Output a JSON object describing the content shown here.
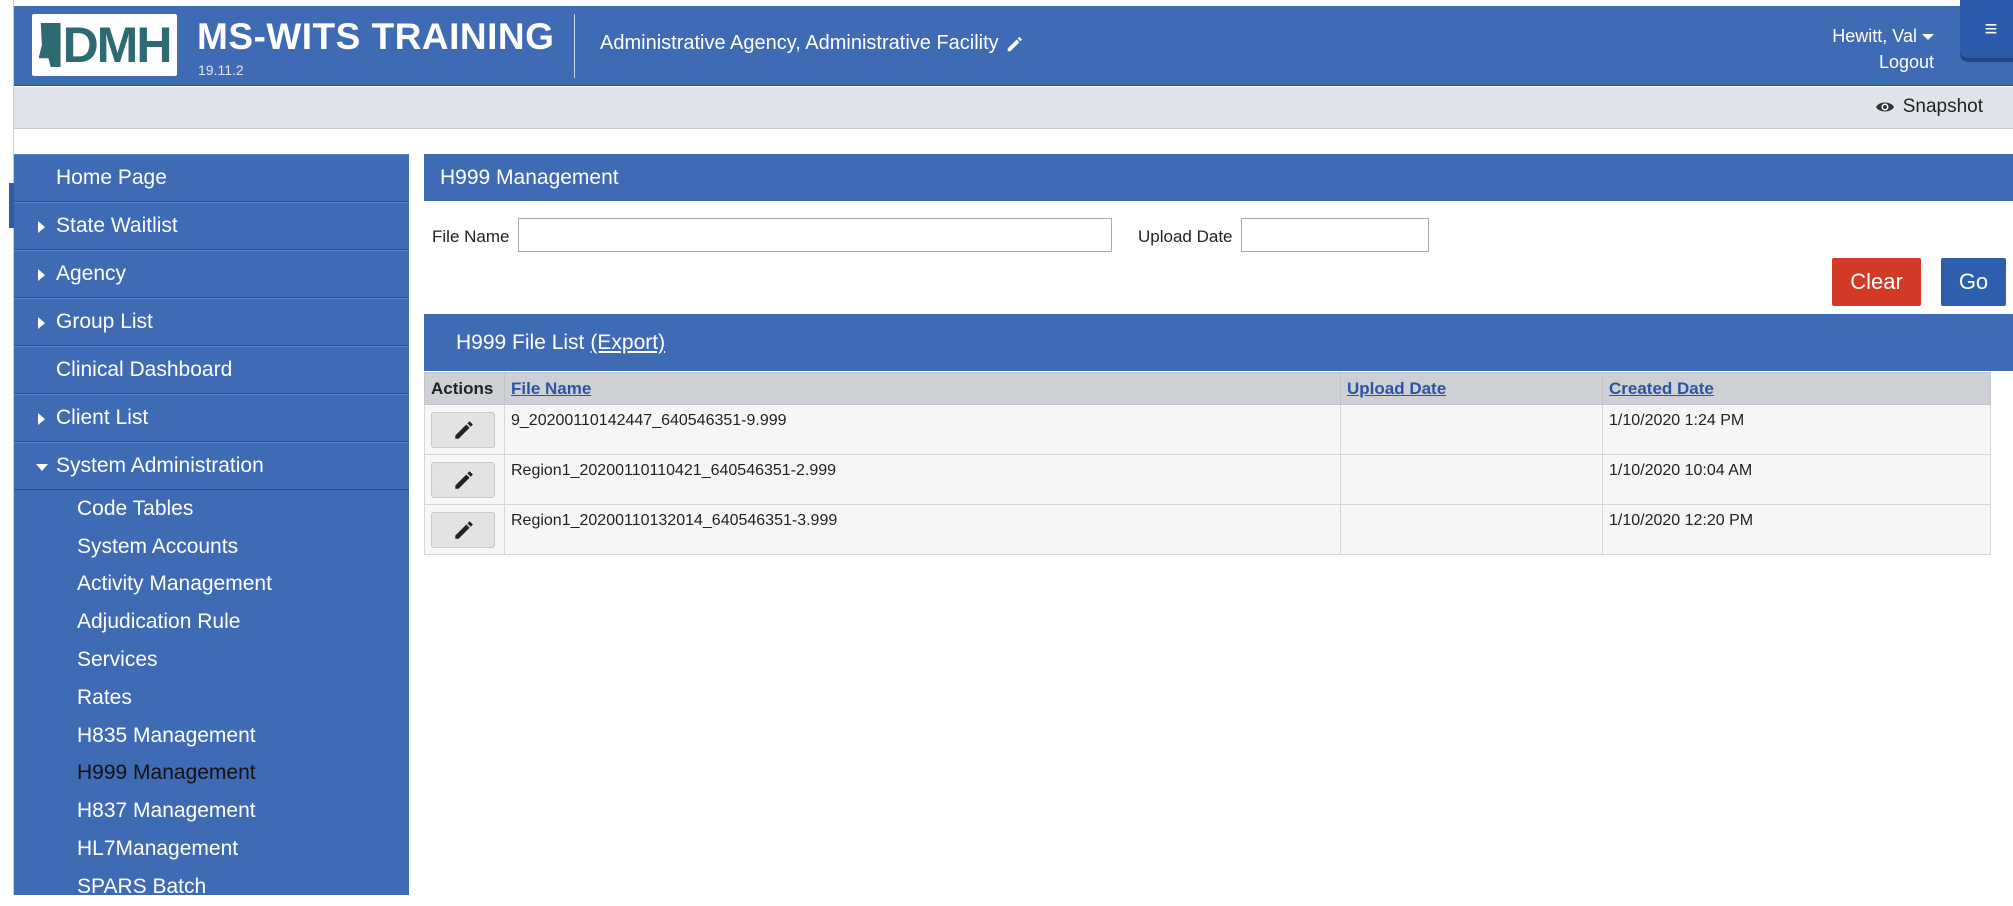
{
  "header": {
    "logo_text": "DMH",
    "app_title": "MS-WITS TRAINING",
    "version": "19.11.2",
    "facility": "Administrative Agency, Administrative Facility",
    "user_name": "Hewitt, Val",
    "logout_label": "Logout",
    "menu_icon": "≡"
  },
  "subbar": {
    "snapshot_label": "Snapshot"
  },
  "sidebar": {
    "items": [
      {
        "label": "Home Page"
      },
      {
        "label": "State Waitlist"
      },
      {
        "label": "Agency"
      },
      {
        "label": "Group List"
      },
      {
        "label": "Clinical Dashboard"
      },
      {
        "label": "Client List"
      },
      {
        "label": "System Administration"
      }
    ],
    "sub_items": [
      {
        "label": "Code Tables"
      },
      {
        "label": "System Accounts"
      },
      {
        "label": "Activity Management"
      },
      {
        "label": "Adjudication Rule"
      },
      {
        "label": "Services"
      },
      {
        "label": "Rates"
      },
      {
        "label": "H835 Management"
      },
      {
        "label": "H999 Management"
      },
      {
        "label": "H837 Management"
      },
      {
        "label": "HL7Management"
      },
      {
        "label": "SPARS Batch"
      }
    ]
  },
  "main": {
    "panel_title": "H999 Management",
    "filters": {
      "file_name_label": "File Name",
      "file_name_value": "",
      "upload_date_label": "Upload Date",
      "upload_date_value": ""
    },
    "clear_label": "Clear",
    "go_label": "Go",
    "list_title": "H999 File List",
    "export_label": "(Export)",
    "columns": {
      "actions": "Actions",
      "file_name": "File Name",
      "upload_date": "Upload Date",
      "created_date": "Created Date"
    },
    "rows": [
      {
        "file_name": "9_20200110142447_640546351-9.999",
        "upload_date": "",
        "created_date": "1/10/2020 1:24 PM"
      },
      {
        "file_name": "Region1_20200110110421_640546351-2.999",
        "upload_date": "",
        "created_date": "1/10/2020 10:04 AM"
      },
      {
        "file_name": "Region1_20200110132014_640546351-3.999",
        "upload_date": "",
        "created_date": "1/10/2020 12:20 PM"
      }
    ]
  }
}
